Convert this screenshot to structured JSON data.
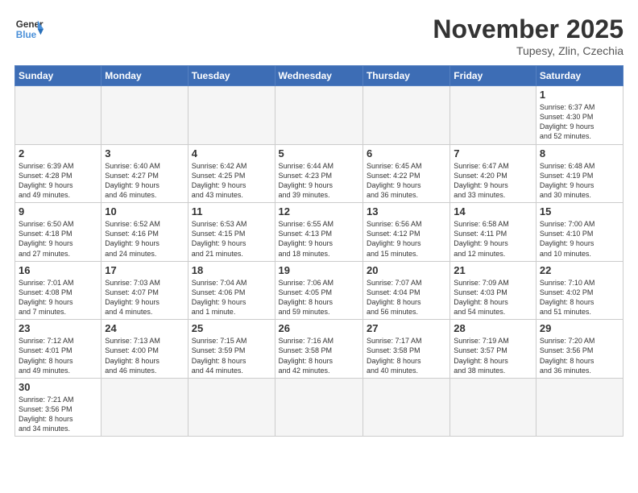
{
  "logo": {
    "line1": "General",
    "line2": "Blue"
  },
  "title": "November 2025",
  "location": "Tupesy, Zlin, Czechia",
  "days_header": [
    "Sunday",
    "Monday",
    "Tuesday",
    "Wednesday",
    "Thursday",
    "Friday",
    "Saturday"
  ],
  "weeks": [
    [
      {
        "day": "",
        "info": ""
      },
      {
        "day": "",
        "info": ""
      },
      {
        "day": "",
        "info": ""
      },
      {
        "day": "",
        "info": ""
      },
      {
        "day": "",
        "info": ""
      },
      {
        "day": "",
        "info": ""
      },
      {
        "day": "1",
        "info": "Sunrise: 6:37 AM\nSunset: 4:30 PM\nDaylight: 9 hours\nand 52 minutes."
      }
    ],
    [
      {
        "day": "2",
        "info": "Sunrise: 6:39 AM\nSunset: 4:28 PM\nDaylight: 9 hours\nand 49 minutes."
      },
      {
        "day": "3",
        "info": "Sunrise: 6:40 AM\nSunset: 4:27 PM\nDaylight: 9 hours\nand 46 minutes."
      },
      {
        "day": "4",
        "info": "Sunrise: 6:42 AM\nSunset: 4:25 PM\nDaylight: 9 hours\nand 43 minutes."
      },
      {
        "day": "5",
        "info": "Sunrise: 6:44 AM\nSunset: 4:23 PM\nDaylight: 9 hours\nand 39 minutes."
      },
      {
        "day": "6",
        "info": "Sunrise: 6:45 AM\nSunset: 4:22 PM\nDaylight: 9 hours\nand 36 minutes."
      },
      {
        "day": "7",
        "info": "Sunrise: 6:47 AM\nSunset: 4:20 PM\nDaylight: 9 hours\nand 33 minutes."
      },
      {
        "day": "8",
        "info": "Sunrise: 6:48 AM\nSunset: 4:19 PM\nDaylight: 9 hours\nand 30 minutes."
      }
    ],
    [
      {
        "day": "9",
        "info": "Sunrise: 6:50 AM\nSunset: 4:18 PM\nDaylight: 9 hours\nand 27 minutes."
      },
      {
        "day": "10",
        "info": "Sunrise: 6:52 AM\nSunset: 4:16 PM\nDaylight: 9 hours\nand 24 minutes."
      },
      {
        "day": "11",
        "info": "Sunrise: 6:53 AM\nSunset: 4:15 PM\nDaylight: 9 hours\nand 21 minutes."
      },
      {
        "day": "12",
        "info": "Sunrise: 6:55 AM\nSunset: 4:13 PM\nDaylight: 9 hours\nand 18 minutes."
      },
      {
        "day": "13",
        "info": "Sunrise: 6:56 AM\nSunset: 4:12 PM\nDaylight: 9 hours\nand 15 minutes."
      },
      {
        "day": "14",
        "info": "Sunrise: 6:58 AM\nSunset: 4:11 PM\nDaylight: 9 hours\nand 12 minutes."
      },
      {
        "day": "15",
        "info": "Sunrise: 7:00 AM\nSunset: 4:10 PM\nDaylight: 9 hours\nand 10 minutes."
      }
    ],
    [
      {
        "day": "16",
        "info": "Sunrise: 7:01 AM\nSunset: 4:08 PM\nDaylight: 9 hours\nand 7 minutes."
      },
      {
        "day": "17",
        "info": "Sunrise: 7:03 AM\nSunset: 4:07 PM\nDaylight: 9 hours\nand 4 minutes."
      },
      {
        "day": "18",
        "info": "Sunrise: 7:04 AM\nSunset: 4:06 PM\nDaylight: 9 hours\nand 1 minute."
      },
      {
        "day": "19",
        "info": "Sunrise: 7:06 AM\nSunset: 4:05 PM\nDaylight: 8 hours\nand 59 minutes."
      },
      {
        "day": "20",
        "info": "Sunrise: 7:07 AM\nSunset: 4:04 PM\nDaylight: 8 hours\nand 56 minutes."
      },
      {
        "day": "21",
        "info": "Sunrise: 7:09 AM\nSunset: 4:03 PM\nDaylight: 8 hours\nand 54 minutes."
      },
      {
        "day": "22",
        "info": "Sunrise: 7:10 AM\nSunset: 4:02 PM\nDaylight: 8 hours\nand 51 minutes."
      }
    ],
    [
      {
        "day": "23",
        "info": "Sunrise: 7:12 AM\nSunset: 4:01 PM\nDaylight: 8 hours\nand 49 minutes."
      },
      {
        "day": "24",
        "info": "Sunrise: 7:13 AM\nSunset: 4:00 PM\nDaylight: 8 hours\nand 46 minutes."
      },
      {
        "day": "25",
        "info": "Sunrise: 7:15 AM\nSunset: 3:59 PM\nDaylight: 8 hours\nand 44 minutes."
      },
      {
        "day": "26",
        "info": "Sunrise: 7:16 AM\nSunset: 3:58 PM\nDaylight: 8 hours\nand 42 minutes."
      },
      {
        "day": "27",
        "info": "Sunrise: 7:17 AM\nSunset: 3:58 PM\nDaylight: 8 hours\nand 40 minutes."
      },
      {
        "day": "28",
        "info": "Sunrise: 7:19 AM\nSunset: 3:57 PM\nDaylight: 8 hours\nand 38 minutes."
      },
      {
        "day": "29",
        "info": "Sunrise: 7:20 AM\nSunset: 3:56 PM\nDaylight: 8 hours\nand 36 minutes."
      }
    ],
    [
      {
        "day": "30",
        "info": "Sunrise: 7:21 AM\nSunset: 3:56 PM\nDaylight: 8 hours\nand 34 minutes."
      },
      {
        "day": "",
        "info": ""
      },
      {
        "day": "",
        "info": ""
      },
      {
        "day": "",
        "info": ""
      },
      {
        "day": "",
        "info": ""
      },
      {
        "day": "",
        "info": ""
      },
      {
        "day": "",
        "info": ""
      }
    ]
  ]
}
